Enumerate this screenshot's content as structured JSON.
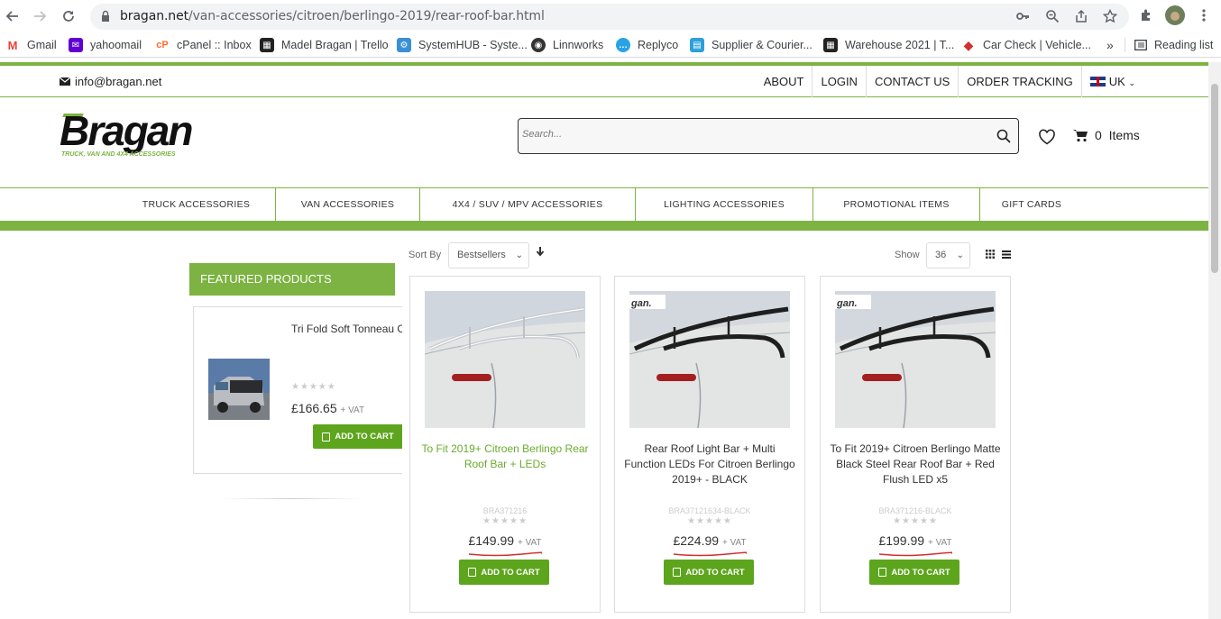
{
  "browser": {
    "url_host": "bragan.net",
    "url_path": "/van-accessories/citroen/berlingo-2019/rear-roof-bar.html",
    "bookmarks": [
      {
        "label": "Gmail",
        "color": "#ea4335",
        "glyph": "M"
      },
      {
        "label": "yahoomail",
        "color": "#6001d2",
        "glyph": "✉"
      },
      {
        "label": "cPanel :: Inbox",
        "color": "#ff6c2c",
        "glyph": "cP"
      },
      {
        "label": "Madel Bragan | Trello",
        "color": "#222222",
        "glyph": "▦"
      },
      {
        "label": "SystemHUB - Syste...",
        "color": "#3a8fd6",
        "glyph": "⚙"
      },
      {
        "label": "Linnworks",
        "color": "#333333",
        "glyph": "◉"
      },
      {
        "label": "Replyco",
        "color": "#29a3e6",
        "glyph": "💬"
      },
      {
        "label": "Supplier & Courier...",
        "color": "#2d9fd9",
        "glyph": "▤"
      },
      {
        "label": "Warehouse 2021 | T...",
        "color": "#222222",
        "glyph": "▦"
      },
      {
        "label": "Car Check | Vehicle...",
        "color": "#d32f2f",
        "glyph": "◆"
      }
    ],
    "bookmarks_more": "»",
    "reading_list": "Reading list"
  },
  "topbar": {
    "email": "info@bragan.net",
    "links": [
      "ABOUT",
      "LOGIN",
      "CONTACT US",
      "ORDER TRACKING"
    ],
    "region": "UK"
  },
  "header": {
    "logo_text": "Bragan",
    "logo_tagline": "TRUCK, VAN AND 4X4        ACCESSORIES",
    "search_placeholder": "Search...",
    "cart_count": "0",
    "cart_label": "Items"
  },
  "nav": {
    "items": [
      "TRUCK ACCESSORIES",
      "VAN ACCESSORIES",
      "4X4 / SUV / MPV ACCESSORIES",
      "LIGHTING ACCESSORIES",
      "PROMOTIONAL ITEMS",
      "GIFT CARDS"
    ]
  },
  "sidebar": {
    "heading": "FEATURED PRODUCTS",
    "product": {
      "title": "Tri Fold Soft Tonneau C",
      "price": "£166.65",
      "vat": "+ VAT",
      "button": "ADD TO CART"
    }
  },
  "toolbar": {
    "sort_label": "Sort By",
    "sort_value": "Bestsellers",
    "show_label": "Show",
    "show_value": "36"
  },
  "products": [
    {
      "title": "To Fit 2019+ Citroen Berlingo Rear Roof Bar + LEDs",
      "sku": "BRA371216",
      "price": "£149.99",
      "vat": "+ VAT",
      "button": "ADD TO CART",
      "bar_color": "#c9ccd0"
    },
    {
      "title": "Rear Roof Light Bar + Multi Function LEDs For Citroen Berlingo 2019+ - BLACK",
      "sku": "BRA37121634-BLACK",
      "price": "£224.99",
      "vat": "+ VAT",
      "button": "ADD TO CART",
      "bar_color": "#1e1e1e",
      "watermark": "gan."
    },
    {
      "title": "To Fit 2019+ Citroen Berlingo Matte Black Steel Rear Roof Bar + Red Flush LED x5",
      "sku": "BRA371216-BLACK",
      "price": "£199.99",
      "vat": "+ VAT",
      "button": "ADD TO CART",
      "bar_color": "#1e1e1e",
      "watermark": "gan."
    }
  ],
  "brand_colors": {
    "green": "#7cb342",
    "button_green": "#5da51d",
    "underline_red": "#d32f2f"
  }
}
